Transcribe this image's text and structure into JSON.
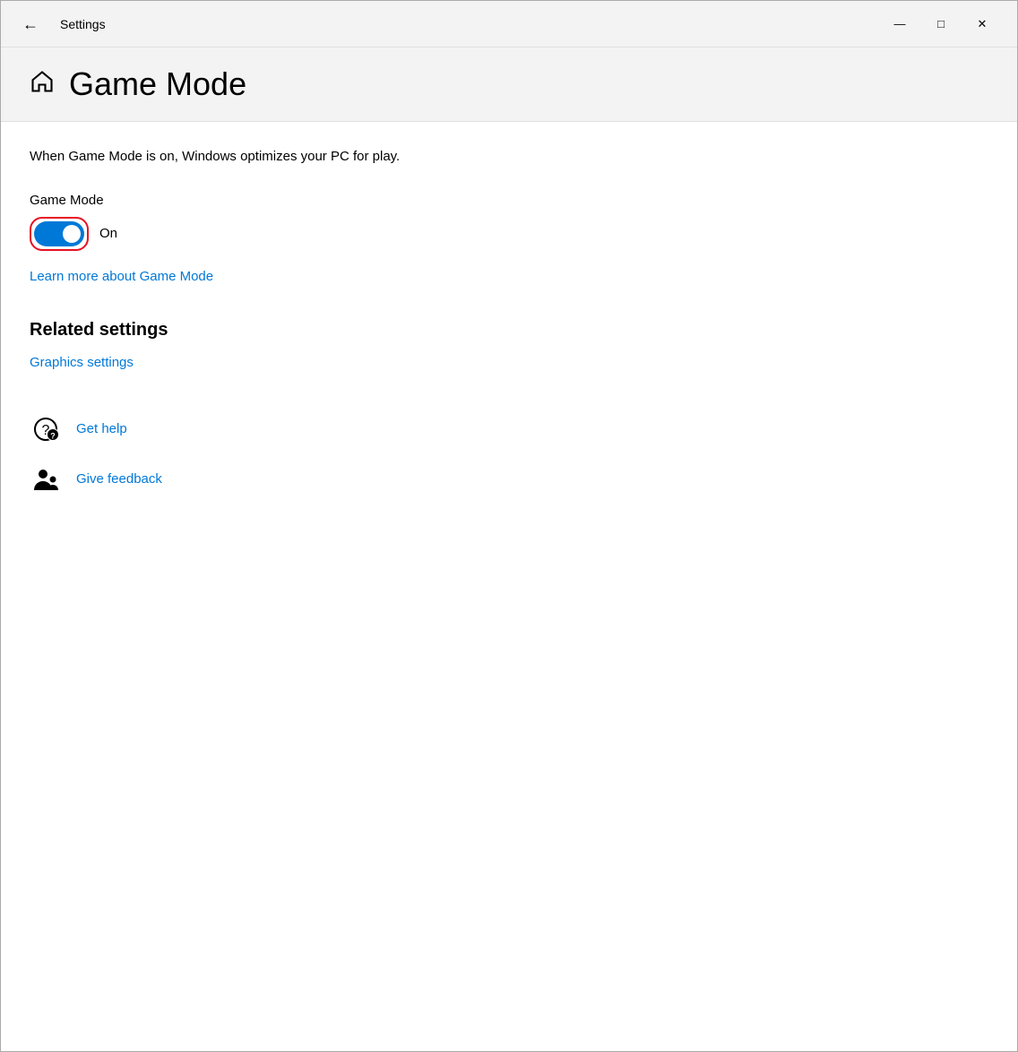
{
  "window": {
    "title": "Settings"
  },
  "titlebar": {
    "back_label": "←",
    "title": "Settings",
    "minimize_label": "—",
    "maximize_label": "□",
    "close_label": "✕"
  },
  "header": {
    "page_title": "Game Mode"
  },
  "content": {
    "description": "When Game Mode is on, Windows optimizes your PC for play.",
    "game_mode_label": "Game Mode",
    "toggle_state": "On",
    "toggle_is_on": true,
    "learn_more_link": "Learn more about Game Mode",
    "related_settings_heading": "Related settings",
    "graphics_settings_link": "Graphics settings",
    "get_help_link": "Get help",
    "give_feedback_link": "Give feedback"
  },
  "colors": {
    "toggle_on": "#0078d7",
    "link": "#0078d7",
    "highlight_border": "#e81123"
  }
}
